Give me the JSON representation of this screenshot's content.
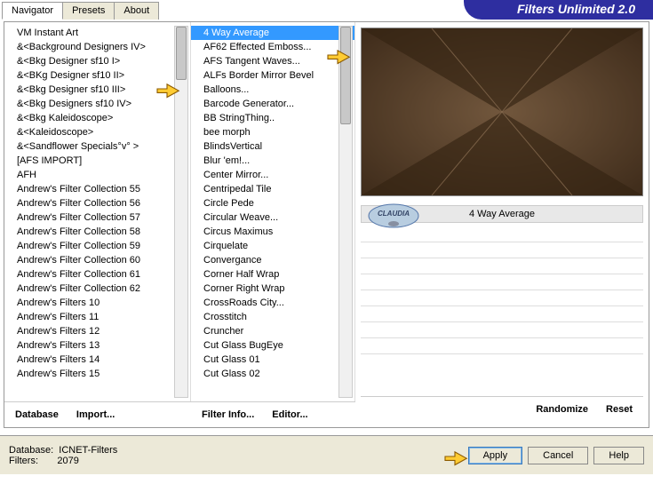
{
  "app": {
    "title": "Filters Unlimited 2.0"
  },
  "tabs": {
    "t0": "Navigator",
    "t1": "Presets",
    "t2": "About"
  },
  "categories": [
    "VM Instant Art",
    "&<Background Designers IV>",
    "&<Bkg Designer sf10 I>",
    "&<BKg Designer sf10 II>",
    "&<Bkg Designer sf10 III>",
    "&<Bkg Designers sf10 IV>",
    "&<Bkg Kaleidoscope>",
    "&<Kaleidoscope>",
    "&<Sandflower Specials°v° >",
    "[AFS IMPORT]",
    "AFH",
    "Andrew's Filter Collection 55",
    "Andrew's Filter Collection 56",
    "Andrew's Filter Collection 57",
    "Andrew's Filter Collection 58",
    "Andrew's Filter Collection 59",
    "Andrew's Filter Collection 60",
    "Andrew's Filter Collection 61",
    "Andrew's Filter Collection 62",
    "Andrew's Filters 10",
    "Andrew's Filters 11",
    "Andrew's Filters 12",
    "Andrew's Filters 13",
    "Andrew's Filters 14",
    "Andrew's Filters 15"
  ],
  "filters": [
    "4 Way Average",
    "AF62 Effected Emboss...",
    "AFS Tangent Waves...",
    "ALFs Border Mirror Bevel",
    "Balloons...",
    "Barcode Generator...",
    "BB StringThing..",
    "bee morph",
    "BlindsVertical",
    "Blur 'em!...",
    "Center Mirror...",
    "Centripedal Tile",
    "Circle Pede",
    "Circular Weave...",
    "Circus Maximus",
    "Cirquelate",
    "Convergance",
    "Corner Half Wrap",
    "Corner Right Wrap",
    "CrossRoads City...",
    "Crosstitch",
    "Cruncher",
    "Cut Glass  BugEye",
    "Cut Glass 01",
    "Cut Glass 02"
  ],
  "selected_filter_index": 0,
  "buttons": {
    "database": "Database",
    "import": "Import...",
    "filterinfo": "Filter Info...",
    "editor": "Editor...",
    "randomize": "Randomize",
    "reset": "Reset",
    "apply": "Apply",
    "cancel": "Cancel",
    "help": "Help"
  },
  "preview": {
    "filter_name": "4 Way Average",
    "watermark": "CLAUDIA"
  },
  "footer": {
    "db_label": "Database:",
    "db_value": "ICNET-Filters",
    "filters_label": "Filters:",
    "filters_count": "2079"
  }
}
